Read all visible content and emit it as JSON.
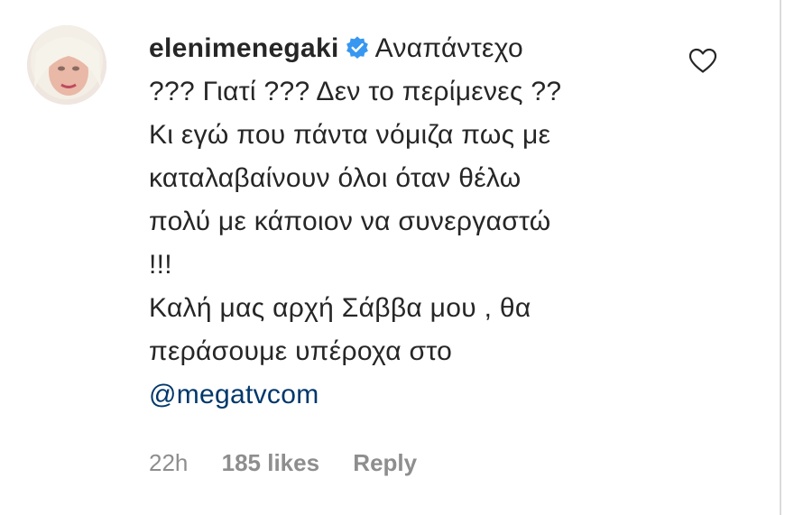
{
  "comment": {
    "username": "elenimenegaki",
    "icons": {
      "verified": "verified-badge-icon",
      "like": "heart-outline-icon"
    },
    "first_line_text": "Αναπάντεχο",
    "lines": [
      "??? Γιατί ??? Δεν το περίμενες ??",
      "Κι εγώ που πάντα νόμιζα πως με",
      "καταλαβαίνουν όλοι όταν θέλω",
      "πολύ με κάποιον να συνεργαστώ",
      "!!!",
      "Καλή μας αρχή Σάββα μου , θα",
      "περάσουμε υπέροχα στο"
    ],
    "mention": "@megatvcom"
  },
  "meta": {
    "time": "22h",
    "likes": "185 likes",
    "reply": "Reply"
  },
  "colors": {
    "text": "#262626",
    "secondary": "#8e8e8e",
    "mention": "#00376b",
    "verified": "#3897f0"
  }
}
